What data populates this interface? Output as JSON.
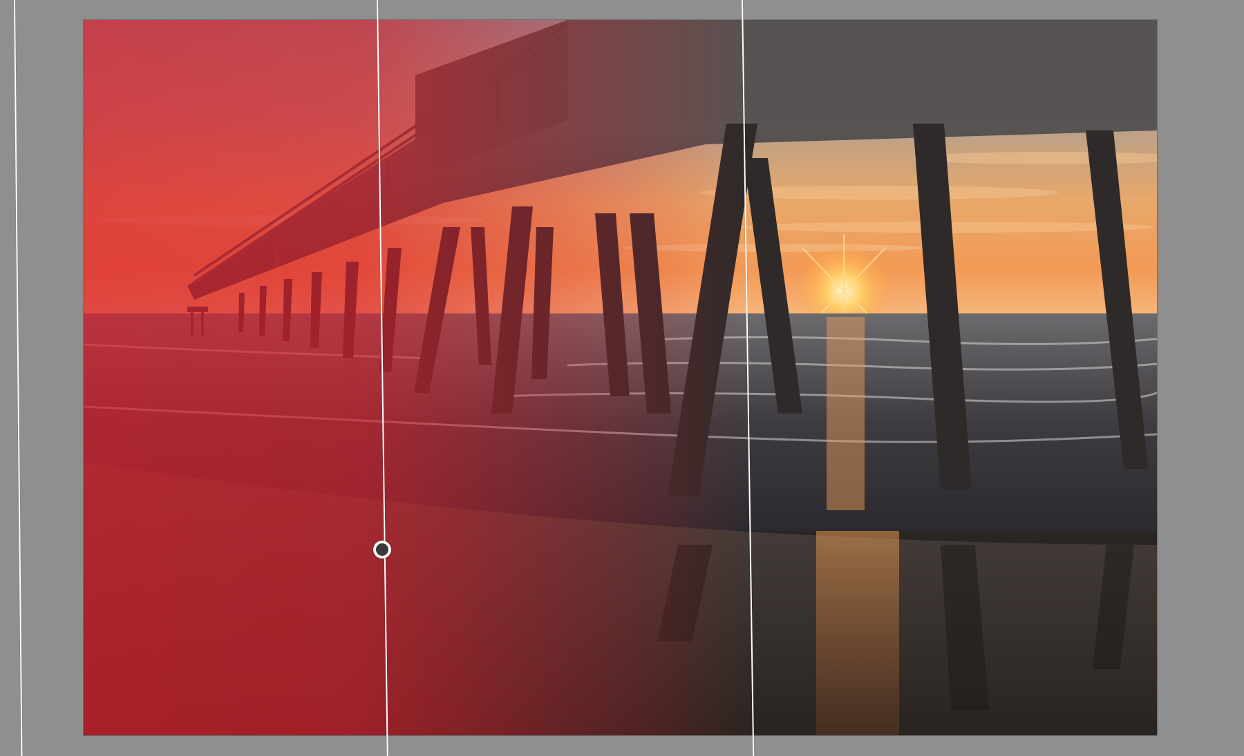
{
  "image": {
    "subject": "pier-at-sunrise",
    "mask": {
      "tool": "linear-gradient-mask",
      "overlay_color": "#d9202e",
      "overlay_opacity": 0.55,
      "pin_color": "#3a3a3a"
    }
  },
  "colors": {
    "workspace_background": "#8f8f8f",
    "guide_line": "#ffffff"
  }
}
